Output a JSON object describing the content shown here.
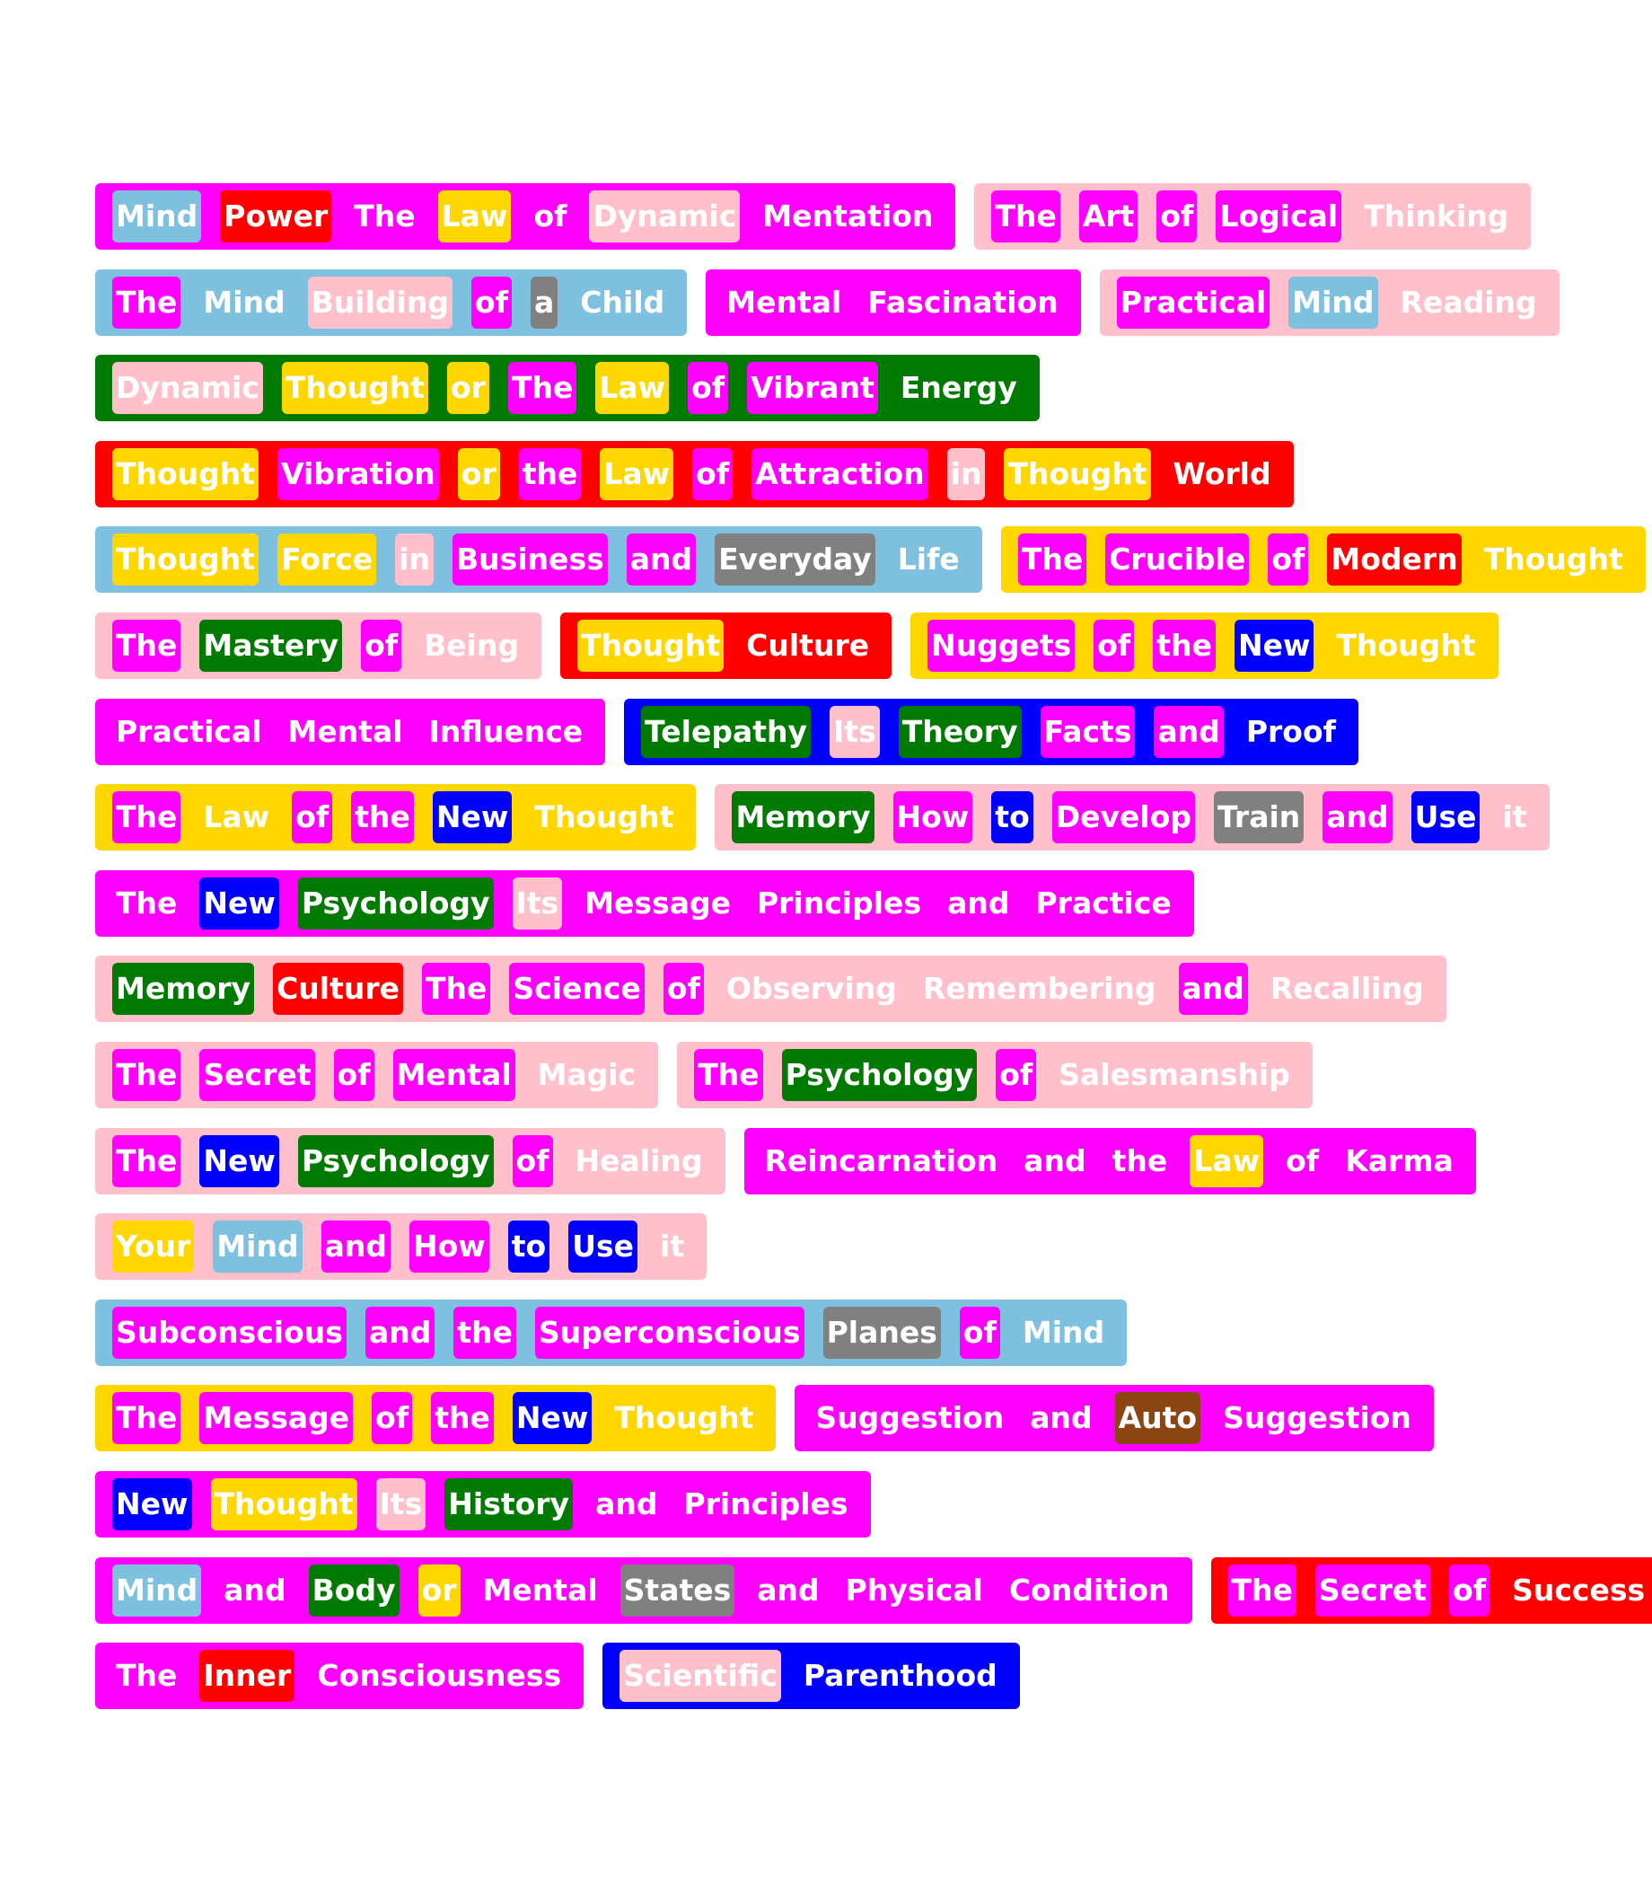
{
  "colors": {
    "M": "#ff00ff",
    "P": "#ffc0cb",
    "S": "#7ec0e0",
    "G": "#007a00",
    "R": "#ff0000",
    "Y": "#ffd700",
    "B": "#0000ff",
    "X": "#808080",
    "N": "#8b4513"
  },
  "rows": [
    [
      {
        "bg": "M",
        "words": [
          [
            "Mind",
            "S"
          ],
          [
            "Power",
            "R"
          ],
          [
            "The",
            ""
          ],
          [
            "Law",
            "Y"
          ],
          [
            "of",
            ""
          ],
          [
            "Dynamic",
            "P"
          ],
          [
            "Mentation",
            ""
          ]
        ]
      },
      {
        "bg": "P",
        "words": [
          [
            "The",
            "M"
          ],
          [
            "Art",
            "M"
          ],
          [
            "of",
            "M"
          ],
          [
            "Logical",
            "M"
          ],
          [
            "Thinking",
            ""
          ]
        ]
      }
    ],
    [
      {
        "bg": "S",
        "words": [
          [
            "The",
            "M"
          ],
          [
            "Mind",
            ""
          ],
          [
            "Building",
            "P"
          ],
          [
            "of",
            "M"
          ],
          [
            "a",
            "X"
          ],
          [
            "Child",
            ""
          ]
        ]
      },
      {
        "bg": "M",
        "words": [
          [
            "Mental",
            ""
          ],
          [
            "Fascination",
            ""
          ]
        ]
      },
      {
        "bg": "P",
        "words": [
          [
            "Practical",
            "M"
          ],
          [
            "Mind",
            "S"
          ],
          [
            "Reading",
            ""
          ]
        ]
      }
    ],
    [
      {
        "bg": "G",
        "words": [
          [
            "Dynamic",
            "P"
          ],
          [
            "Thought",
            "Y"
          ],
          [
            "or",
            "Y"
          ],
          [
            "The",
            "M"
          ],
          [
            "Law",
            "Y"
          ],
          [
            "of",
            "M"
          ],
          [
            "Vibrant",
            "M"
          ],
          [
            "Energy",
            ""
          ]
        ]
      }
    ],
    [
      {
        "bg": "R",
        "words": [
          [
            "Thought",
            "Y"
          ],
          [
            "Vibration",
            "M"
          ],
          [
            "or",
            "Y"
          ],
          [
            "the",
            "M"
          ],
          [
            "Law",
            "Y"
          ],
          [
            "of",
            "M"
          ],
          [
            "Attraction",
            "M"
          ],
          [
            "in",
            "P"
          ],
          [
            "Thought",
            "Y"
          ],
          [
            "World",
            ""
          ]
        ]
      }
    ],
    [
      {
        "bg": "S",
        "words": [
          [
            "Thought",
            "Y"
          ],
          [
            "Force",
            "Y"
          ],
          [
            "in",
            "P"
          ],
          [
            "Business",
            "M"
          ],
          [
            "and",
            "M"
          ],
          [
            "Everyday",
            "X"
          ],
          [
            "Life",
            ""
          ]
        ]
      },
      {
        "bg": "Y",
        "words": [
          [
            "The",
            "M"
          ],
          [
            "Crucible",
            "M"
          ],
          [
            "of",
            "M"
          ],
          [
            "Modern",
            "R"
          ],
          [
            "Thought",
            ""
          ]
        ]
      }
    ],
    [
      {
        "bg": "P",
        "words": [
          [
            "The",
            "M"
          ],
          [
            "Mastery",
            "G"
          ],
          [
            "of",
            "M"
          ],
          [
            "Being",
            ""
          ]
        ]
      },
      {
        "bg": "R",
        "words": [
          [
            "Thought",
            "Y"
          ],
          [
            "Culture",
            ""
          ]
        ]
      },
      {
        "bg": "Y",
        "words": [
          [
            "Nuggets",
            "M"
          ],
          [
            "of",
            "M"
          ],
          [
            "the",
            "M"
          ],
          [
            "New",
            "B"
          ],
          [
            "Thought",
            ""
          ]
        ]
      }
    ],
    [
      {
        "bg": "M",
        "words": [
          [
            "Practical",
            ""
          ],
          [
            "Mental",
            ""
          ],
          [
            "Influence",
            ""
          ]
        ]
      },
      {
        "bg": "B",
        "words": [
          [
            "Telepathy",
            "G"
          ],
          [
            "Its",
            "P"
          ],
          [
            "Theory",
            "G"
          ],
          [
            "Facts",
            "M"
          ],
          [
            "and",
            "M"
          ],
          [
            "Proof",
            ""
          ]
        ]
      }
    ],
    [
      {
        "bg": "Y",
        "words": [
          [
            "The",
            "M"
          ],
          [
            "Law",
            ""
          ],
          [
            "of",
            "M"
          ],
          [
            "the",
            "M"
          ],
          [
            "New",
            "B"
          ],
          [
            "Thought",
            ""
          ]
        ]
      },
      {
        "bg": "P",
        "words": [
          [
            "Memory",
            "G"
          ],
          [
            "How",
            "M"
          ],
          [
            "to",
            "B"
          ],
          [
            "Develop",
            "M"
          ],
          [
            "Train",
            "X"
          ],
          [
            "and",
            "M"
          ],
          [
            "Use",
            "B"
          ],
          [
            "it",
            ""
          ]
        ]
      }
    ],
    [
      {
        "bg": "M",
        "words": [
          [
            "The",
            ""
          ],
          [
            "New",
            "B"
          ],
          [
            "Psychology",
            "G"
          ],
          [
            "Its",
            "P"
          ],
          [
            "Message",
            ""
          ],
          [
            "Principles",
            ""
          ],
          [
            "and",
            ""
          ],
          [
            "Practice",
            ""
          ]
        ]
      }
    ],
    [
      {
        "bg": "P",
        "words": [
          [
            "Memory",
            "G"
          ],
          [
            "Culture",
            "R"
          ],
          [
            "The",
            "M"
          ],
          [
            "Science",
            "M"
          ],
          [
            "of",
            "M"
          ],
          [
            "Observing",
            ""
          ],
          [
            "Remembering",
            ""
          ],
          [
            "and",
            "M"
          ],
          [
            "Recalling",
            ""
          ]
        ]
      }
    ],
    [
      {
        "bg": "P",
        "words": [
          [
            "The",
            "M"
          ],
          [
            "Secret",
            "M"
          ],
          [
            "of",
            "M"
          ],
          [
            "Mental",
            "M"
          ],
          [
            "Magic",
            ""
          ]
        ]
      },
      {
        "bg": "P",
        "words": [
          [
            "The",
            "M"
          ],
          [
            "Psychology",
            "G"
          ],
          [
            "of",
            "M"
          ],
          [
            "Salesmanship",
            ""
          ]
        ]
      }
    ],
    [
      {
        "bg": "P",
        "words": [
          [
            "The",
            "M"
          ],
          [
            "New",
            "B"
          ],
          [
            "Psychology",
            "G"
          ],
          [
            "of",
            "M"
          ],
          [
            "Healing",
            ""
          ]
        ]
      },
      {
        "bg": "M",
        "words": [
          [
            "Reincarnation",
            ""
          ],
          [
            "and",
            ""
          ],
          [
            "the",
            ""
          ],
          [
            "Law",
            "Y"
          ],
          [
            "of",
            ""
          ],
          [
            "Karma",
            ""
          ]
        ]
      }
    ],
    [
      {
        "bg": "P",
        "words": [
          [
            "Your",
            "Y"
          ],
          [
            "Mind",
            "S"
          ],
          [
            "and",
            "M"
          ],
          [
            "How",
            "M"
          ],
          [
            "to",
            "B"
          ],
          [
            "Use",
            "B"
          ],
          [
            "it",
            ""
          ]
        ]
      }
    ],
    [
      {
        "bg": "S",
        "words": [
          [
            "Subconscious",
            "M"
          ],
          [
            "and",
            "M"
          ],
          [
            "the",
            "M"
          ],
          [
            "Superconscious",
            "M"
          ],
          [
            "Planes",
            "X"
          ],
          [
            "of",
            "M"
          ],
          [
            "Mind",
            ""
          ]
        ]
      }
    ],
    [
      {
        "bg": "Y",
        "words": [
          [
            "The",
            "M"
          ],
          [
            "Message",
            "M"
          ],
          [
            "of",
            "M"
          ],
          [
            "the",
            "M"
          ],
          [
            "New",
            "B"
          ],
          [
            "Thought",
            ""
          ]
        ]
      },
      {
        "bg": "M",
        "words": [
          [
            "Suggestion",
            ""
          ],
          [
            "and",
            ""
          ],
          [
            "Auto",
            "N"
          ],
          [
            "Suggestion",
            ""
          ]
        ]
      }
    ],
    [
      {
        "bg": "M",
        "words": [
          [
            "New",
            "B"
          ],
          [
            "Thought",
            "Y"
          ],
          [
            "Its",
            "P"
          ],
          [
            "History",
            "G"
          ],
          [
            "and",
            ""
          ],
          [
            "Principles",
            ""
          ]
        ]
      }
    ],
    [
      {
        "bg": "M",
        "words": [
          [
            "Mind",
            "S"
          ],
          [
            "and",
            ""
          ],
          [
            "Body",
            "G"
          ],
          [
            "or",
            "Y"
          ],
          [
            "Mental",
            ""
          ],
          [
            "States",
            "X"
          ],
          [
            "and",
            ""
          ],
          [
            "Physical",
            ""
          ],
          [
            "Condition",
            ""
          ]
        ]
      },
      {
        "bg": "R",
        "words": [
          [
            "The",
            "M"
          ],
          [
            "Secret",
            "M"
          ],
          [
            "of",
            "M"
          ],
          [
            "Success",
            ""
          ]
        ]
      }
    ],
    [
      {
        "bg": "M",
        "words": [
          [
            "The",
            ""
          ],
          [
            "Inner",
            "R"
          ],
          [
            "Consciousness",
            ""
          ]
        ]
      },
      {
        "bg": "B",
        "words": [
          [
            "Scientific",
            "P"
          ],
          [
            "Parenthood",
            ""
          ]
        ]
      }
    ]
  ]
}
